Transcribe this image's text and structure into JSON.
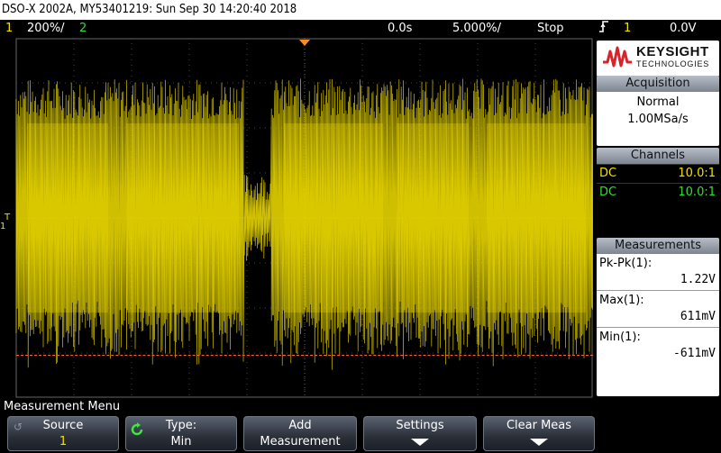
{
  "title": "DSO-X 2002A, MY53401219: Sun Sep 30 14:20:40 2018",
  "status": {
    "ch1_num": "1",
    "ch1_scale": "200%/",
    "ch2_num": "2",
    "time_delay": "0.0s",
    "time_scale": "5.000%/",
    "run_state": "Stop",
    "trig_icon": "rising-edge-icon",
    "trig_source": "1",
    "trig_level": "0.0V"
  },
  "colors": {
    "ch1": "#f3e000",
    "ch2": "#33dd33",
    "trigger_marker": "#ff8c1a",
    "ref_line": "#ff6633"
  },
  "ground_marker": {
    "label": "1",
    "t_label": "T"
  },
  "logo": {
    "brand": "KEYSIGHT",
    "sub": "TECHNOLOGIES"
  },
  "acquisition": {
    "title": "Acquisition",
    "mode": "Normal",
    "rate": "1.00MSa/s"
  },
  "channels": {
    "title": "Channels",
    "rows": [
      {
        "coupling": "DC",
        "probe": "10.0:1"
      },
      {
        "coupling": "DC",
        "probe": "10.0:1"
      }
    ]
  },
  "measurements": {
    "title": "Measurements",
    "items": [
      {
        "label": "Pk-Pk(1):",
        "value": "1.22V"
      },
      {
        "label": "Max(1):",
        "value": "611mV"
      },
      {
        "label": "Min(1):",
        "value": "-611mV"
      }
    ]
  },
  "menu": {
    "title": "Measurement Menu",
    "keys": [
      {
        "l1": "Source",
        "l2": "1"
      },
      {
        "l1": "Type:",
        "l2": "Min"
      },
      {
        "l1": "Add",
        "l2": "Measurement"
      },
      {
        "l1": "Settings",
        "l2": ""
      },
      {
        "l1": "Clear Meas",
        "l2": ""
      }
    ]
  }
}
